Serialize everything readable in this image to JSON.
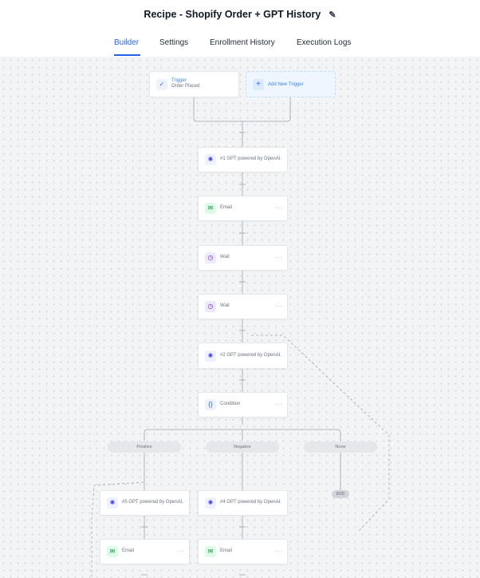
{
  "header": {
    "title": "Recipe - Shopify Order + GPT History",
    "edit_icon": "pencil-icon"
  },
  "tabs": [
    {
      "label": "Builder",
      "active": true
    },
    {
      "label": "Settings",
      "active": false
    },
    {
      "label": "Enrollment History",
      "active": false
    },
    {
      "label": "Execution Logs",
      "active": false
    }
  ],
  "trigger": {
    "title": "Trigger",
    "subtitle": "Order Placed",
    "icon": "check-icon"
  },
  "add_trigger": {
    "label": "Add New Trigger",
    "icon": "plus-icon"
  },
  "actions": {
    "gpt1": {
      "label": "#1 GPT powered by OpenAI",
      "icon": "openai-icon"
    },
    "email1": {
      "label": "Email",
      "icon": "email-icon"
    },
    "wait1": {
      "label": "Wait",
      "icon": "clock-icon"
    },
    "wait2": {
      "label": "Wait",
      "icon": "clock-icon"
    },
    "gpt2": {
      "label": "#2 GPT powered by OpenAI",
      "icon": "openai-icon"
    },
    "condition": {
      "label": "Condition",
      "icon": "braces-icon"
    },
    "gpt5": {
      "label": "#5 GPT powered by OpenAI",
      "icon": "openai-icon"
    },
    "gpt4": {
      "label": "#4 GPT powered by OpenAI",
      "icon": "openai-icon"
    },
    "email_left": {
      "label": "Email",
      "icon": "email-icon"
    },
    "email_mid": {
      "label": "Email",
      "icon": "email-icon"
    }
  },
  "branches": {
    "positive": "Positive",
    "negative": "Negative",
    "none": "None"
  },
  "end_label": "END",
  "more_label": "···",
  "colors": {
    "accent": "#2563eb",
    "canvas": "#f3f4f6"
  }
}
